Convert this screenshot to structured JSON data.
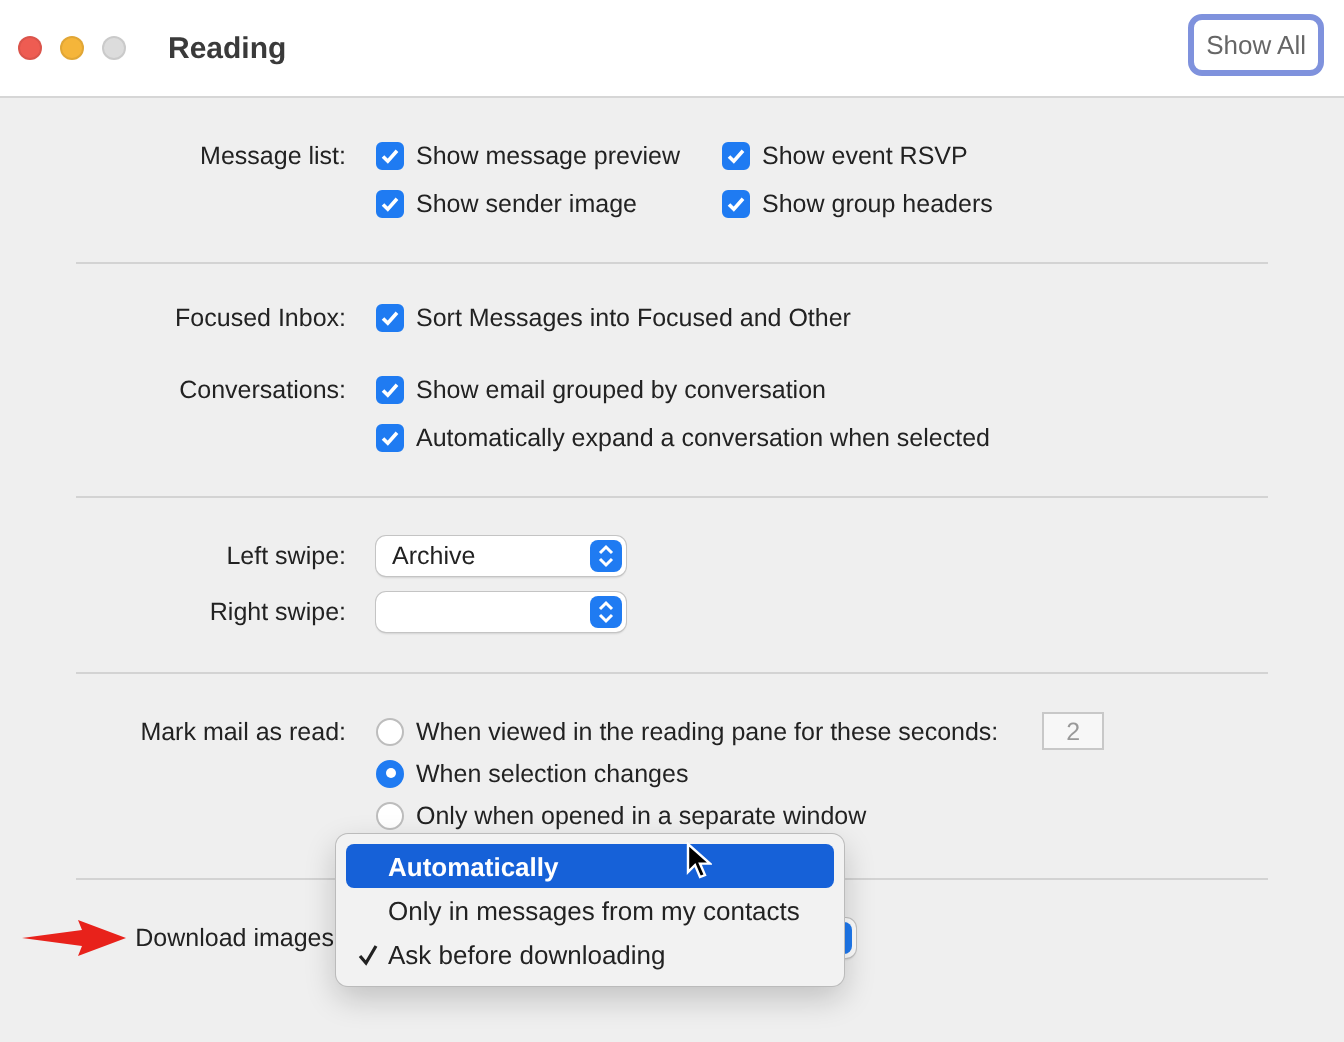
{
  "window": {
    "title": "Reading",
    "show_all_button": "Show All"
  },
  "message_list": {
    "label": "Message list:",
    "options": [
      {
        "label": "Show message preview",
        "checked": true
      },
      {
        "label": "Show event RSVP",
        "checked": true
      },
      {
        "label": "Show sender image",
        "checked": true
      },
      {
        "label": "Show group headers",
        "checked": true
      }
    ]
  },
  "focused_inbox": {
    "label": "Focused Inbox:",
    "options": [
      {
        "label": "Sort Messages into Focused and Other",
        "checked": true
      }
    ]
  },
  "conversations": {
    "label": "Conversations:",
    "options": [
      {
        "label": "Show email grouped by conversation",
        "checked": true
      },
      {
        "label": "Automatically expand a conversation when selected",
        "checked": true
      }
    ]
  },
  "swipes": [
    {
      "label": "Left swipe:",
      "value": "Archive"
    },
    {
      "label": "Right swipe:"
    }
  ],
  "mark_as_read": {
    "label": "Mark mail as read:",
    "seconds": "2",
    "options": [
      {
        "label": "When viewed in the reading pane for these seconds:",
        "selected": false
      },
      {
        "label": "When selection changes",
        "selected": true
      },
      {
        "label": "Only when opened in a separate window",
        "selected": false
      }
    ]
  },
  "download_images": {
    "label": "Download images",
    "menu": [
      {
        "label": "Automatically",
        "highlighted": true,
        "checked": false
      },
      {
        "label": "Only in messages from my contacts",
        "highlighted": false,
        "checked": false
      },
      {
        "label": "Ask before downloading",
        "highlighted": false,
        "checked": true
      }
    ]
  }
}
